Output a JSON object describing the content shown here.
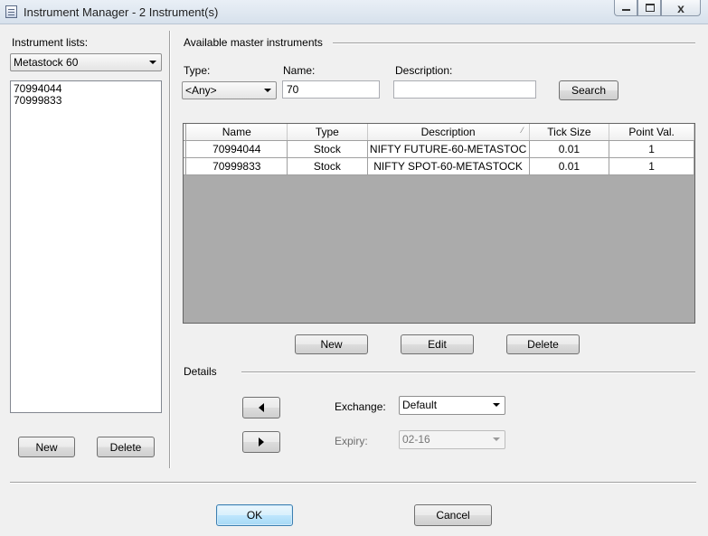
{
  "window": {
    "title": "Instrument Manager - 2 Instrument(s)",
    "min_icon": "minimize-icon",
    "max_icon": "maximize-icon",
    "close_icon": "close-icon",
    "close_glyph": "x"
  },
  "left_panel": {
    "lists_label": "Instrument lists:",
    "selected_list": "Metastock 60",
    "items": [
      "70994044",
      "70999833"
    ],
    "new_label": "New",
    "delete_label": "Delete"
  },
  "master": {
    "section_label": "Available master instruments",
    "type_label": "Type:",
    "type_value": "<Any>",
    "name_label": "Name:",
    "name_value": "70",
    "description_label": "Description:",
    "description_value": "",
    "search_label": "Search",
    "table": {
      "columns": [
        "Name",
        "Type",
        "Description",
        "Tick Size",
        "Point Val."
      ],
      "sort_indicator": "⁄",
      "rows": [
        [
          "70994044",
          "Stock",
          "NIFTY FUTURE-60-METASTOC",
          "0.01",
          "1"
        ],
        [
          "70999833",
          "Stock",
          "NIFTY SPOT-60-METASTOCK",
          "0.01",
          "1"
        ]
      ]
    },
    "new_label": "New",
    "edit_label": "Edit",
    "delete_label": "Delete"
  },
  "details": {
    "section_label": "Details",
    "exchange_label": "Exchange:",
    "exchange_value": "Default",
    "expiry_label": "Expiry:",
    "expiry_value": "02-16",
    "left_icon": "arrow-left-icon",
    "right_icon": "arrow-right-icon"
  },
  "footer": {
    "ok_label": "OK",
    "cancel_label": "Cancel"
  }
}
